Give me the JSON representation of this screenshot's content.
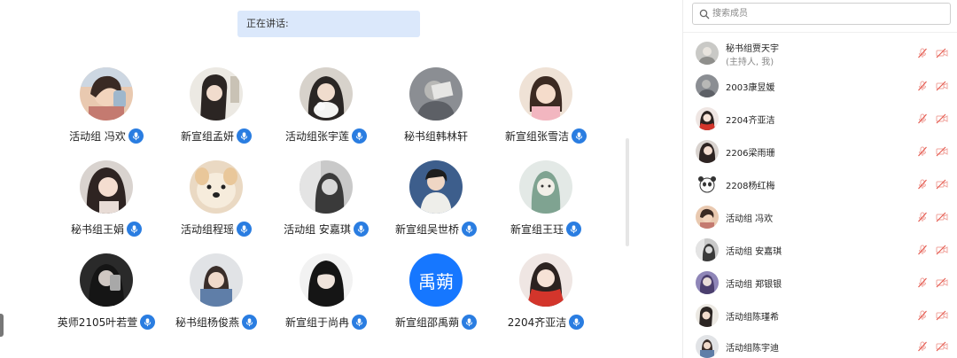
{
  "speaking": {
    "label": "正在讲话:"
  },
  "grid": {
    "participants": [
      {
        "name": "活动组 冯欢",
        "mic": true,
        "avatar": "photo-girl-drinking"
      },
      {
        "name": "新宣组孟妍",
        "mic": true,
        "avatar": "photo-girl-dark"
      },
      {
        "name": "活动组张宇莲",
        "mic": true,
        "avatar": "photo-girl-cat"
      },
      {
        "name": "秘书组韩林轩",
        "mic": false,
        "avatar": "photo-gray"
      },
      {
        "name": "新宣组张雪洁",
        "mic": true,
        "avatar": "photo-girl-pink"
      },
      {
        "name": "秘书组王娟",
        "mic": true,
        "avatar": "photo-girl-hair"
      },
      {
        "name": "活动组程瑶",
        "mic": true,
        "avatar": "photo-dog"
      },
      {
        "name": "活动组 安嘉琪",
        "mic": true,
        "avatar": "photo-girl-bw"
      },
      {
        "name": "新宣组吴世桥",
        "mic": true,
        "avatar": "photo-boy-blue"
      },
      {
        "name": "新宣组王珏",
        "mic": true,
        "avatar": "cartoon-green"
      },
      {
        "name": "英师2105叶若萱",
        "mic": true,
        "avatar": "photo-dark-phone"
      },
      {
        "name": "秘书组杨俊燕",
        "mic": true,
        "avatar": "photo-girl-denim"
      },
      {
        "name": "新宣组于尚冉",
        "mic": true,
        "avatar": "photo-girl-black"
      },
      {
        "name": "新宣组邵禹蒴",
        "mic": true,
        "avatar": "text",
        "avatar_text": "禹蒴"
      },
      {
        "name": "2204齐亚洁",
        "mic": true,
        "avatar": "photo-girl-red"
      }
    ]
  },
  "panel": {
    "search_placeholder": "搜索成员",
    "members": [
      {
        "name": "秘书组贾天宇",
        "sub": "(主持人, 我)",
        "avatar": "photo-gray-light"
      },
      {
        "name": "2003康昱媛",
        "avatar": "photo-gray"
      },
      {
        "name": "2204齐亚洁",
        "avatar": "photo-girl-red"
      },
      {
        "name": "2206梁雨珊",
        "avatar": "photo-girl-hair"
      },
      {
        "name": "2208杨红梅",
        "avatar": "cartoon-panda"
      },
      {
        "name": "活动组 冯欢",
        "avatar": "photo-girl-drinking"
      },
      {
        "name": "活动组 安嘉琪",
        "avatar": "photo-girl-bw"
      },
      {
        "name": "活动组 郑银银",
        "avatar": "photo-purple"
      },
      {
        "name": "活动组陈瑾希",
        "avatar": "photo-girl-dark"
      },
      {
        "name": "活动组陈宇迪",
        "avatar": "photo-girl-denim"
      }
    ]
  },
  "colors": {
    "banner_bg": "#dbe8fb",
    "mic_badge": "#2a7de1",
    "text_avatar_bg": "#1677ff",
    "muted_red": "#e4574c",
    "muted_red_light": "#f0a49e"
  }
}
